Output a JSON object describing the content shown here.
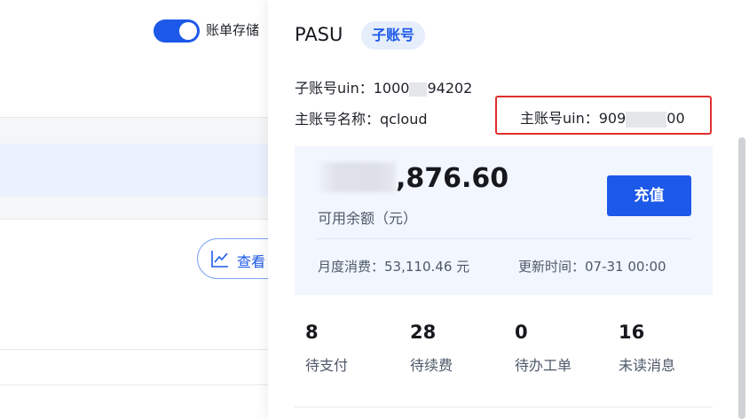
{
  "background": {
    "toggle_label": "账单存储",
    "toggle_on": true,
    "view_button_label": "查看"
  },
  "account": {
    "name": "PASU",
    "tag": "子账号",
    "sub_uin_label": "子账号uin：",
    "sub_uin_value_start": "1000",
    "sub_uin_value_end": "94202",
    "main_name_label": "主账号名称：",
    "main_name_value": "qcloud",
    "main_uin_label": "主账号uin：",
    "main_uin_value_start": "909",
    "main_uin_value_end": "00"
  },
  "summary": {
    "balance_visible": ",876.60",
    "balance_label": "可用余额（元）",
    "recharge_label": "充值",
    "month_cost_label": "月度消费：",
    "month_cost_value": "53,110.46 元",
    "update_time_label": "更新时间：",
    "update_time_value": "07-31 00:00"
  },
  "stats": [
    {
      "value": "8",
      "label": "待支付"
    },
    {
      "value": "28",
      "label": "待续费"
    },
    {
      "value": "0",
      "label": "待办工单"
    },
    {
      "value": "16",
      "label": "未读消息"
    }
  ],
  "colors": {
    "primary": "#1d59e8",
    "highlight_border": "#e0302e",
    "summary_bg": "#f2f6fe",
    "tag_bg": "#e6eefc"
  }
}
